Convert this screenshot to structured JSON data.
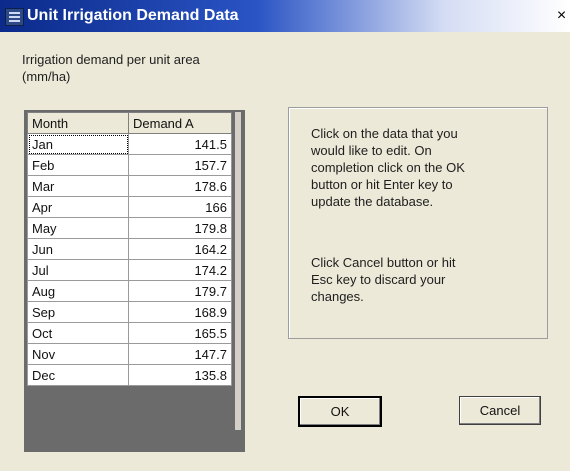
{
  "window": {
    "title": "Unit Irrigation Demand Data",
    "close_glyph": "×"
  },
  "description": {
    "line1": "Irrigation demand per unit area",
    "line2": "(mm/ha)"
  },
  "table": {
    "headers": [
      "Month",
      "Demand A"
    ],
    "rows": [
      {
        "month": "Jan",
        "value": "141.5"
      },
      {
        "month": "Feb",
        "value": "157.7"
      },
      {
        "month": "Mar",
        "value": "178.6"
      },
      {
        "month": "Apr",
        "value": "166"
      },
      {
        "month": "May",
        "value": "179.8"
      },
      {
        "month": "Jun",
        "value": "164.2"
      },
      {
        "month": "Jul",
        "value": "174.2"
      },
      {
        "month": "Aug",
        "value": "179.7"
      },
      {
        "month": "Sep",
        "value": "168.9"
      },
      {
        "month": "Oct",
        "value": "165.5"
      },
      {
        "month": "Nov",
        "value": "147.7"
      },
      {
        "month": "Dec",
        "value": "135.8"
      }
    ]
  },
  "info": {
    "para1": [
      "Click on the data that you",
      "would like to edit. On",
      "completion click on the OK",
      "button or hit Enter key to",
      "update the database."
    ],
    "para2": [
      "Click Cancel button or hit",
      "Esc key to discard your",
      "changes."
    ]
  },
  "buttons": {
    "ok": "OK",
    "cancel": "Cancel"
  },
  "colors": {
    "titlebar_start": "#0b2a8a",
    "dialog_bg": "#ece9d8"
  }
}
